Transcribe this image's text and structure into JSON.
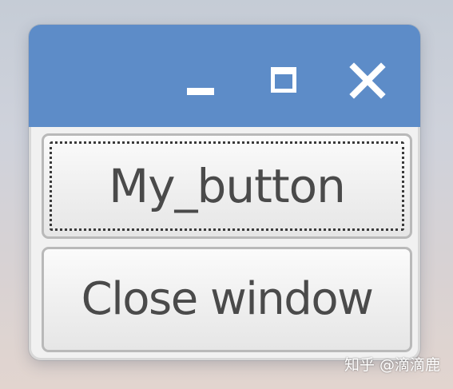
{
  "window": {
    "controls": [
      {
        "name": "minimize",
        "icon": "minimize-icon"
      },
      {
        "name": "maximize",
        "icon": "maximize-icon"
      },
      {
        "name": "close",
        "icon": "close-icon"
      }
    ]
  },
  "buttons": {
    "my_button_label": "My_button",
    "close_window_label": "Close window"
  },
  "watermark": {
    "text": "知乎 @滴滴鹿"
  },
  "colors": {
    "titlebar": "#5d8cc8",
    "client_background": "#f1f1f1",
    "button_text": "#4a4a4a"
  }
}
